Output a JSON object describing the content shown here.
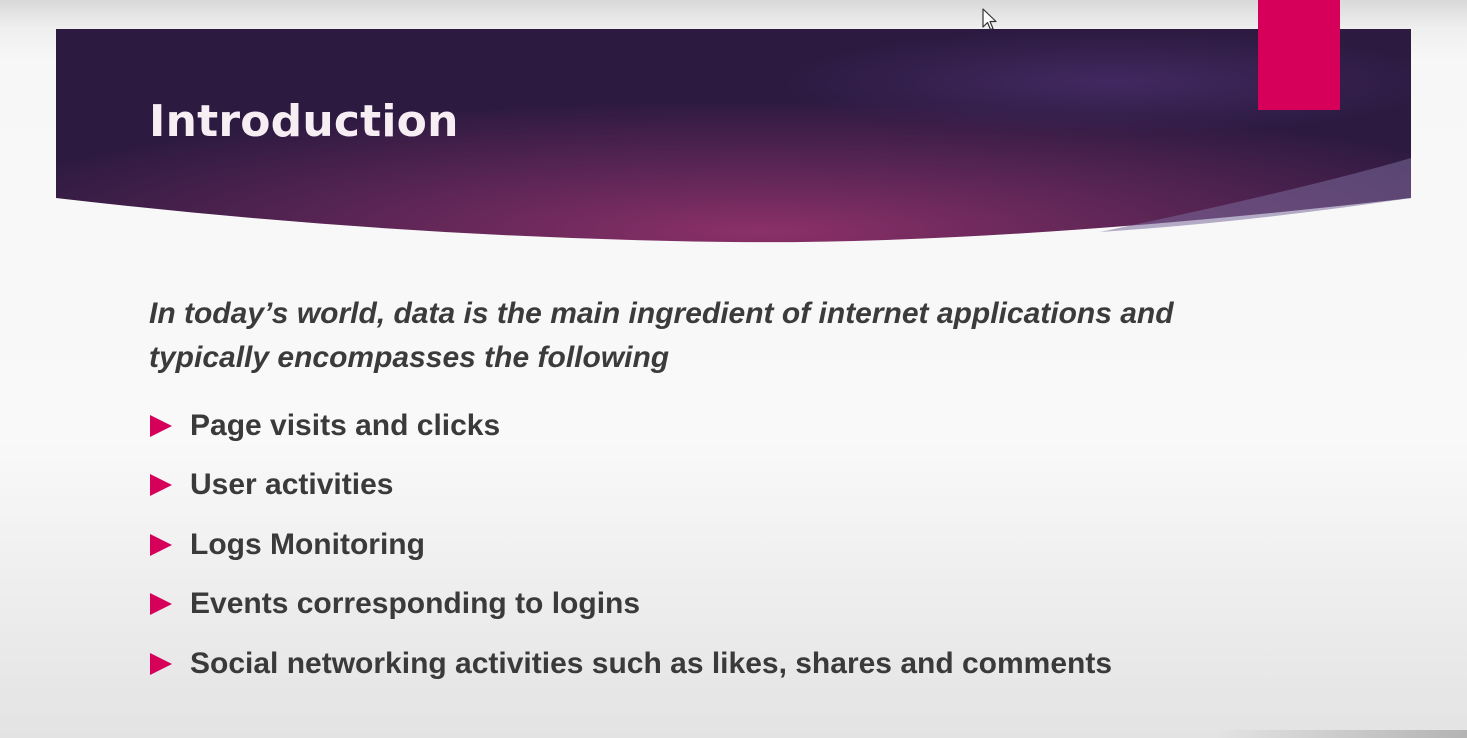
{
  "slide": {
    "title": "Introduction",
    "intro_text": "In today’s world, data is the main ingredient of internet applications and typically encompasses the following",
    "bullets": [
      "Page visits and clicks",
      "User activities",
      "Logs Monitoring",
      "Events corresponding to logins",
      "Social networking activities such as likes, shares and comments"
    ]
  },
  "colors": {
    "banner_dark": "#2a1a3f",
    "banner_mid": "#7a2c62",
    "accent": "#d6005a",
    "body_text": "#3a3a3a"
  },
  "icons": {
    "bullet": "triangle-right-icon",
    "pointer": "mouse-cursor-icon"
  }
}
